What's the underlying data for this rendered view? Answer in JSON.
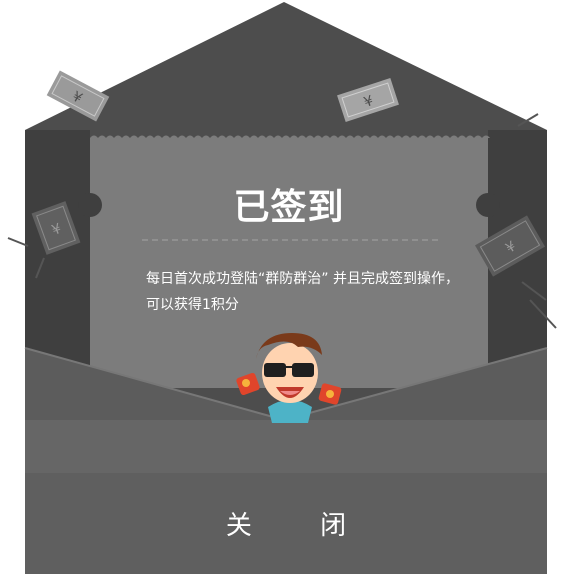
{
  "dialog": {
    "title": "已签到",
    "message": "每日首次成功登陆“群防群治” 并且完成签到操作，可以获得1积分",
    "close_label": "关 闭"
  },
  "icons": {
    "bill_symbol": "¥",
    "mascot": "sunglasses-cartoon-boy-icon",
    "envelope": "envelope-icon"
  },
  "colors": {
    "envelope_back": "#4d4d4d",
    "letter": "#7c7c7c",
    "pocket": "#666666",
    "close_bar": "#5f5f5f",
    "text": "#ffffff"
  }
}
